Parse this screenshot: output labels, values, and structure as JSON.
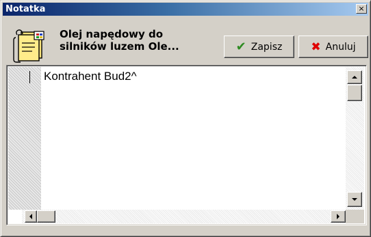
{
  "window": {
    "title": "Notatka",
    "close_glyph": "×"
  },
  "header": {
    "icon": "notes-document-icon",
    "title": "Olej napędowy do\nsilników luzem Ole..."
  },
  "toolbar": {
    "save_label": "Zapisz",
    "save_icon": "checkmark-icon",
    "save_glyph": "✔",
    "cancel_label": "Anuluj",
    "cancel_icon": "cross-icon",
    "cancel_glyph": "✖"
  },
  "editor": {
    "text": "Kontrahent Bud2^"
  },
  "colors": {
    "title_bar_start": "#0a246a",
    "title_bar_end": "#a6caf0",
    "window_face": "#d4d0c8",
    "save_accent": "#2e8b22",
    "cancel_accent": "#e00000"
  }
}
